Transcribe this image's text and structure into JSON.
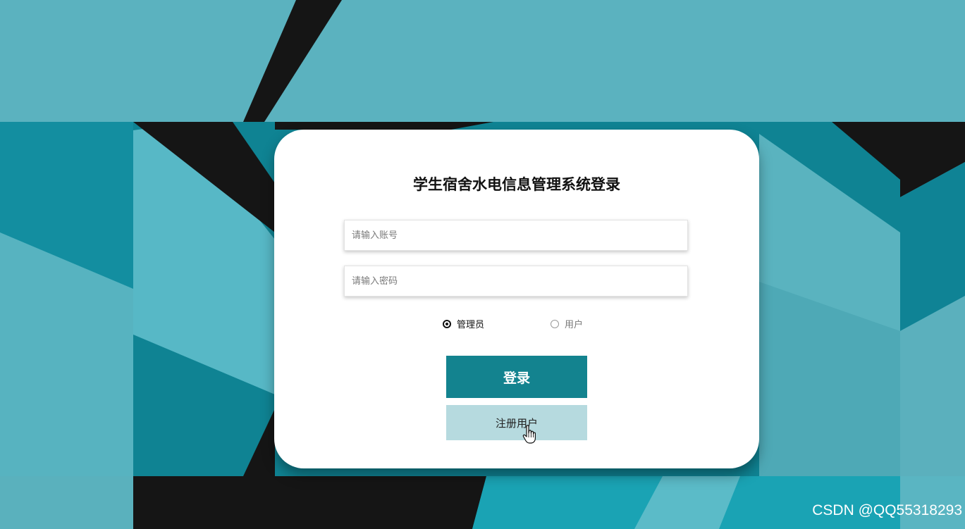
{
  "login": {
    "title": "学生宿舍水电信息管理系统登录",
    "account_placeholder": "请输入账号",
    "password_placeholder": "请输入密码",
    "roles": [
      {
        "label": "管理员",
        "selected": true
      },
      {
        "label": "用户",
        "selected": false
      }
    ],
    "login_label": "登录",
    "register_label": "注册用户"
  },
  "watermark": "CSDN @QQ55318293",
  "colors": {
    "primary": "#13838f",
    "secondary": "#b6dadf",
    "background": "#5ab1bd"
  },
  "icons": {
    "cursor": "hand-pointer-icon"
  }
}
